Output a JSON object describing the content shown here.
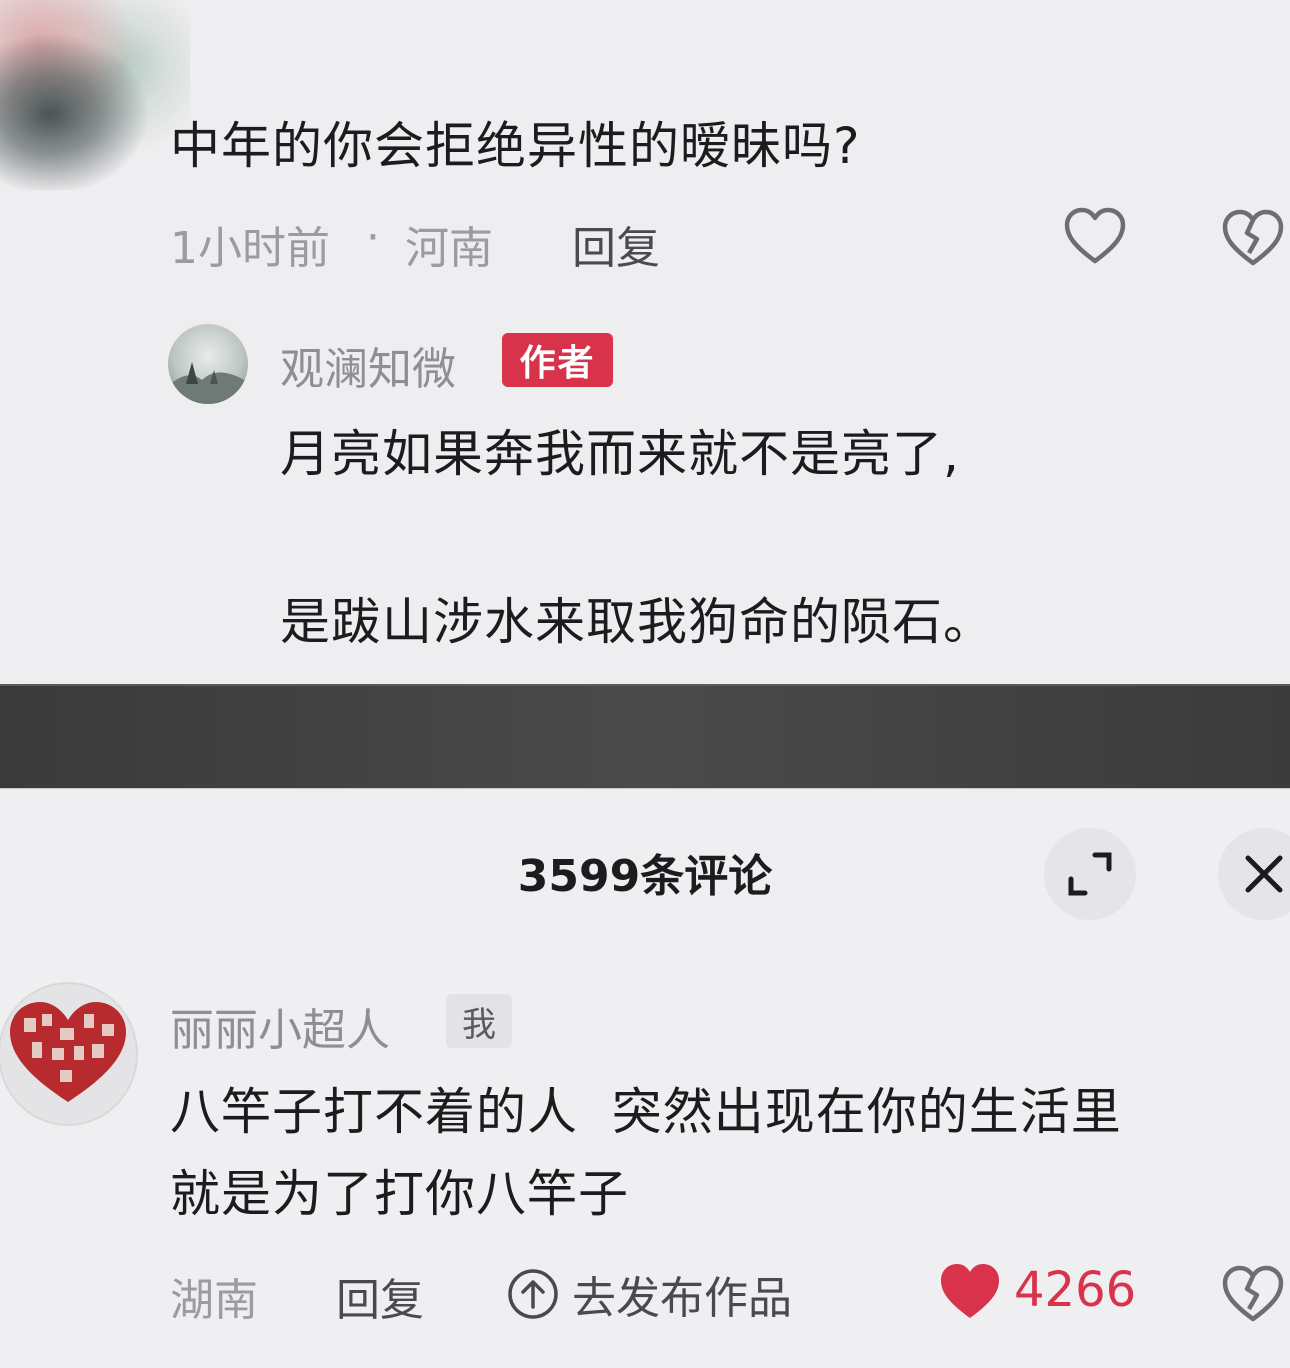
{
  "top_comment": {
    "text": "中年的你会拒绝异性的暧昧吗?",
    "time": "1小时前",
    "separator": "·",
    "location": "河南",
    "reply_label": "回复",
    "like_icon": "heart-outline-icon",
    "dislike_icon": "broken-heart-icon"
  },
  "author_reply": {
    "username": "观澜知微",
    "badge": "作者",
    "line1": "月亮如果奔我而来就不是亮了,",
    "line2": "是跋山涉水来取我狗命的陨石。"
  },
  "comments_panel": {
    "title": "3599条评论",
    "expand_icon": "expand-icon",
    "close_icon": "close-icon"
  },
  "my_comment": {
    "username": "丽丽小超人",
    "badge": "我",
    "line1": "八竿子打不着的人  突然出现在你的生活里",
    "line2": "就是为了打你八竿子",
    "location": "湖南",
    "reply_label": "回复",
    "publish_label": "去发布作品",
    "like_count": "4266"
  },
  "colors": {
    "accent_red": "#d8334a",
    "meta_gray": "#9c9ca0",
    "background": "#efeef0"
  }
}
